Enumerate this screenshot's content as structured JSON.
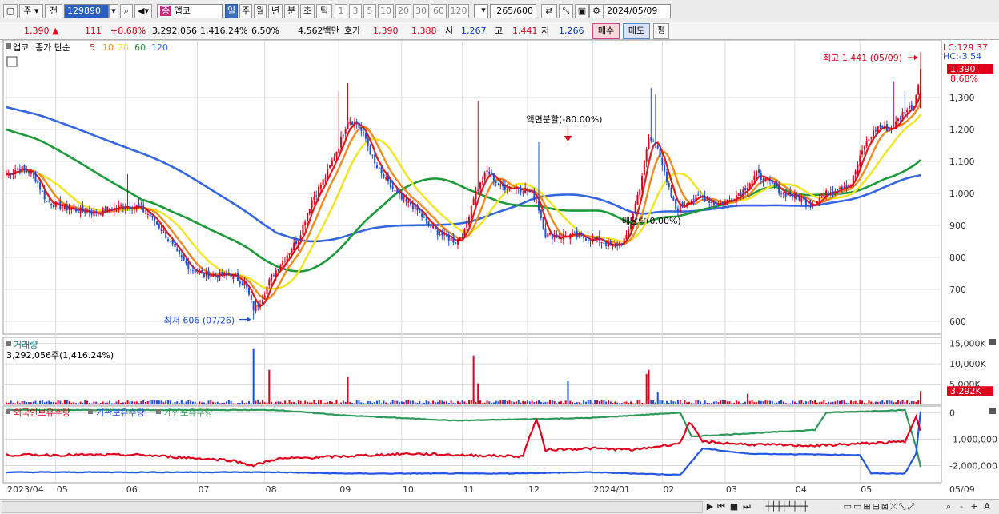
{
  "toolbar": {
    "market_label": "주",
    "prev_label": "전",
    "code": "129890",
    "stock_name_icon": "종",
    "stock_name": "앱코",
    "period_day": "일",
    "period_week": "주",
    "period_month": "월",
    "period_year": "년",
    "period_min": "분",
    "period_tick": "초",
    "period_tik": "틱",
    "intervals": [
      "1",
      "3",
      "5",
      "10",
      "20",
      "30",
      "60",
      "120"
    ],
    "count": "265",
    "count_total": "/600",
    "date": "2024/05/09"
  },
  "quote": {
    "price": "1,390",
    "change_arrow": "▲",
    "change": "111",
    "change_pct": "+8.68%",
    "volume": "3,292,056",
    "volume_pct": "1,416.24%",
    "turnover_pct": "6.50%",
    "trade_value": "4,562백만",
    "ask_label": "호가",
    "ask": "1,390",
    "bid": "1,388",
    "open_label": "시",
    "open": "1,267",
    "high_label": "고",
    "high": "1,441",
    "low_label": "저",
    "low": "1,266",
    "buy_label": "매수",
    "sell_label": "매도",
    "eval_label": "평"
  },
  "colors": {
    "up": "#e0001b",
    "down": "#1a4fd6",
    "ma5": "#e31b1b",
    "ma10": "#f08a1c",
    "ma20": "#f2e41c",
    "ma60": "#1a9b38",
    "ma120": "#3366e0",
    "foreign": "#e0001b",
    "institution": "#2255e0",
    "individual": "#2e9a5a"
  },
  "chart_data": [
    {
      "type": "candlestick",
      "note": "approximate daily OHLC estimated from the figure",
      "legend_stock": "앱코",
      "legend_price": "종가 단순",
      "ma_periods": [
        "5",
        "10",
        "20",
        "60",
        "120"
      ],
      "ylim": [
        560,
        1480
      ],
      "yticks": [
        600,
        700,
        800,
        900,
        "1,000",
        "1,100",
        "1,200",
        "1,300"
      ],
      "xticks": [
        "2023/04",
        "05",
        "06",
        "07",
        "08",
        "09",
        "10",
        "11",
        "12",
        "2024/01",
        "02",
        "03",
        "04",
        "05"
      ],
      "last_date_label": "05/09",
      "lc_label": "LC:129.37",
      "hc_label": "HC:-3.54",
      "last_price_label": "1,390",
      "last_change_label": "8.68%",
      "annotations": {
        "high": "최고 1,441 (05/09)",
        "low": "최저 606 (07/26)",
        "split": "액면분할(-80.00%)",
        "dividend": "배당락(0.00%)"
      },
      "keypoints_close": [
        [
          0,
          1060
        ],
        [
          6,
          1080
        ],
        [
          12,
          1060
        ],
        [
          18,
          975
        ],
        [
          26,
          955
        ],
        [
          34,
          945
        ],
        [
          40,
          940
        ],
        [
          46,
          950
        ],
        [
          52,
          960
        ],
        [
          58,
          960
        ],
        [
          64,
          930
        ],
        [
          70,
          880
        ],
        [
          76,
          810
        ],
        [
          82,
          765
        ],
        [
          88,
          745
        ],
        [
          94,
          745
        ],
        [
          100,
          745
        ],
        [
          106,
          720
        ],
        [
          110,
          640
        ],
        [
          113,
          660
        ],
        [
          118,
          740
        ],
        [
          124,
          800
        ],
        [
          130,
          860
        ],
        [
          136,
          980
        ],
        [
          142,
          1050
        ],
        [
          148,
          1150
        ],
        [
          152,
          1230
        ],
        [
          156,
          1220
        ],
        [
          160,
          1170
        ],
        [
          164,
          1090
        ],
        [
          170,
          1030
        ],
        [
          176,
          980
        ],
        [
          182,
          955
        ],
        [
          188,
          900
        ],
        [
          194,
          870
        ],
        [
          200,
          850
        ],
        [
          204,
          880
        ],
        [
          208,
          990
        ],
        [
          214,
          1070
        ],
        [
          220,
          1020
        ],
        [
          226,
          1020
        ],
        [
          232,
          1010
        ],
        [
          236,
          980
        ],
        [
          240,
          870
        ],
        [
          246,
          865
        ],
        [
          252,
          870
        ],
        [
          258,
          860
        ],
        [
          264,
          855
        ],
        [
          270,
          830
        ],
        [
          276,
          860
        ],
        [
          282,
          1020
        ],
        [
          286,
          1170
        ],
        [
          290,
          1150
        ],
        [
          294,
          1030
        ],
        [
          298,
          950
        ],
        [
          304,
          980
        ],
        [
          310,
          990
        ],
        [
          316,
          965
        ],
        [
          322,
          980
        ],
        [
          328,
          1010
        ],
        [
          334,
          1060
        ],
        [
          340,
          1030
        ],
        [
          346,
          1000
        ],
        [
          352,
          990
        ],
        [
          358,
          965
        ],
        [
          364,
          995
        ],
        [
          370,
          1020
        ],
        [
          376,
          1030
        ],
        [
          382,
          1150
        ],
        [
          388,
          1210
        ],
        [
          394,
          1200
        ],
        [
          400,
          1260
        ],
        [
          404,
          1275
        ],
        [
          407,
          1390
        ]
      ],
      "last_candle": {
        "open": 1267,
        "high": 1441,
        "low": 1266,
        "close": 1390
      },
      "notable_highs": [
        [
          54,
          1060
        ],
        [
          148,
          1320
        ],
        [
          152,
          1345
        ],
        [
          210,
          1290
        ],
        [
          237,
          1160
        ],
        [
          287,
          1330
        ],
        [
          289,
          1310
        ],
        [
          395,
          1350
        ],
        [
          400,
          1320
        ]
      ]
    },
    {
      "type": "bar",
      "title": "거래량",
      "value_label": "3,292,056주(1,416.24%)",
      "note": "approximate daily volume, thousands of shares",
      "ylim": [
        0,
        16500
      ],
      "yticks": [
        "15,000K",
        "10,000K",
        "5,000K"
      ],
      "last_label": "3,292K",
      "last_pct_label": "1416.24%",
      "spikes_k": [
        [
          110,
          13800
        ],
        [
          117,
          8500
        ],
        [
          152,
          6800
        ],
        [
          208,
          12000
        ],
        [
          210,
          5200
        ],
        [
          250,
          5900
        ],
        [
          285,
          7500
        ],
        [
          286,
          8500
        ],
        [
          290,
          3000
        ],
        [
          330,
          2600
        ],
        [
          407,
          3292
        ]
      ]
    },
    {
      "type": "line",
      "series": [
        {
          "name": "외국인보유수량",
          "points": [
            [
              0,
              -1600000
            ],
            [
              60,
              -1600000
            ],
            [
              100,
              -1800000
            ],
            [
              110,
              -2000000
            ],
            [
              120,
              -1750000
            ],
            [
              150,
              -1650000
            ],
            [
              180,
              -1550000
            ],
            [
              200,
              -1600000
            ],
            [
              230,
              -1650000
            ],
            [
              232,
              -1100000
            ],
            [
              236,
              -250000
            ],
            [
              240,
              -1400000
            ],
            [
              260,
              -1350000
            ],
            [
              280,
              -1400000
            ],
            [
              300,
              -1150000
            ],
            [
              304,
              -350000
            ],
            [
              310,
              -1100000
            ],
            [
              330,
              -1200000
            ],
            [
              360,
              -1250000
            ],
            [
              400,
              -1100000
            ],
            [
              405,
              -100000
            ],
            [
              407,
              -700000
            ]
          ]
        },
        {
          "name": "기관보유수량",
          "points": [
            [
              0,
              -2250000
            ],
            [
              120,
              -2250000
            ],
            [
              150,
              -2300000
            ],
            [
              220,
              -2300000
            ],
            [
              260,
              -2250000
            ],
            [
              300,
              -2350000
            ],
            [
              310,
              -1350000
            ],
            [
              330,
              -1550000
            ],
            [
              380,
              -1600000
            ],
            [
              385,
              -2300000
            ],
            [
              400,
              -2300000
            ],
            [
              405,
              -1550000
            ],
            [
              407,
              50000
            ]
          ]
        },
        {
          "name": "개인보유수량",
          "points": [
            [
              0,
              100000
            ],
            [
              120,
              100000
            ],
            [
              150,
              -100000
            ],
            [
              200,
              -300000
            ],
            [
              260,
              -200000
            ],
            [
              300,
              0
            ],
            [
              305,
              -900000
            ],
            [
              360,
              -650000
            ],
            [
              365,
              0
            ],
            [
              400,
              100000
            ],
            [
              405,
              -1300000
            ],
            [
              407,
              -2050000
            ]
          ]
        }
      ],
      "ylim": [
        -2650000,
        250000
      ],
      "yticks": [
        "0",
        "-1,000,000",
        "-2,000,000"
      ]
    }
  ],
  "bottombar": {
    "buttons": [
      "▶",
      "⏮",
      "■",
      "⏭",
      "-",
      "+",
      "A"
    ]
  }
}
